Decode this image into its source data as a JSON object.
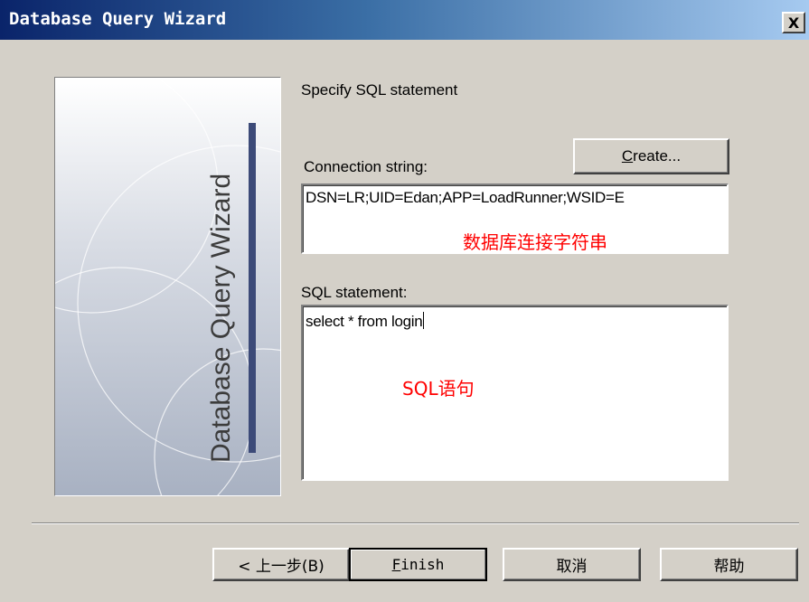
{
  "window": {
    "title": "Database Query Wizard",
    "close_glyph": "X"
  },
  "banner": {
    "label": "Database Query Wizard",
    "accent_color": "#3c4a78"
  },
  "header": {
    "instruction": "Specify SQL statement"
  },
  "connection": {
    "label": "Connection string:",
    "create_button": "Create...",
    "create_mnemonic": "C",
    "value": "DSN=LR;UID=Edan;APP=LoadRunner;WSID=E",
    "annotation": "数据库连接字符串"
  },
  "sql": {
    "label": "SQL statement:",
    "value": "select * from login",
    "annotation": "SQL语句"
  },
  "footer": {
    "back_button": "< 上一步(B)",
    "finish_button": "Finish",
    "finish_mnemonic": "F",
    "cancel_button": "取消",
    "help_button": "帮助"
  },
  "colors": {
    "dialog_bg": "#d4d0c8",
    "title_start": "#0a246a",
    "title_end": "#a6caf0",
    "annotation": "#ff0000"
  }
}
